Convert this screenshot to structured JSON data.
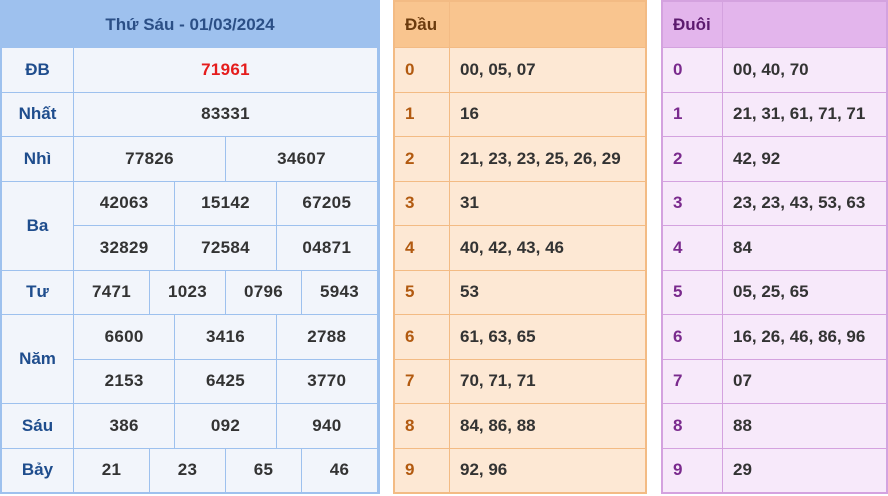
{
  "results": {
    "title": "Thứ Sáu - 01/03/2024",
    "rows": [
      {
        "label": "ĐB",
        "values": [
          "71961"
        ],
        "special": true
      },
      {
        "label": "Nhất",
        "values": [
          "83331"
        ]
      },
      {
        "label": "Nhì",
        "values": [
          "77826",
          "34607"
        ]
      },
      {
        "label": "Ba",
        "values": [
          "42063",
          "15142",
          "67205",
          "32829",
          "72584",
          "04871"
        ]
      },
      {
        "label": "Tư",
        "values": [
          "7471",
          "1023",
          "0796",
          "5943"
        ]
      },
      {
        "label": "Năm",
        "values": [
          "6600",
          "3416",
          "2788",
          "2153",
          "6425",
          "3770"
        ]
      },
      {
        "label": "Sáu",
        "values": [
          "386",
          "092",
          "940"
        ]
      },
      {
        "label": "Bảy",
        "values": [
          "21",
          "23",
          "65",
          "46"
        ]
      }
    ]
  },
  "dau": {
    "header": "Đầu",
    "rows": [
      {
        "key": "0",
        "value": "00, 05, 07"
      },
      {
        "key": "1",
        "value": "16"
      },
      {
        "key": "2",
        "value": "21, 23, 23, 25, 26, 29"
      },
      {
        "key": "3",
        "value": "31"
      },
      {
        "key": "4",
        "value": "40, 42, 43, 46"
      },
      {
        "key": "5",
        "value": "53"
      },
      {
        "key": "6",
        "value": "61, 63, 65"
      },
      {
        "key": "7",
        "value": "70, 71, 71"
      },
      {
        "key": "8",
        "value": "84, 86, 88"
      },
      {
        "key": "9",
        "value": "92, 96"
      }
    ]
  },
  "duoi": {
    "header": "Đuôi",
    "rows": [
      {
        "key": "0",
        "value": "00, 40, 70"
      },
      {
        "key": "1",
        "value": "21, 31, 61, 71, 71"
      },
      {
        "key": "2",
        "value": "42, 92"
      },
      {
        "key": "3",
        "value": "23, 23, 43, 53, 63"
      },
      {
        "key": "4",
        "value": "84"
      },
      {
        "key": "5",
        "value": "05, 25, 65"
      },
      {
        "key": "6",
        "value": "16, 26, 46, 86, 96"
      },
      {
        "key": "7",
        "value": "07"
      },
      {
        "key": "8",
        "value": "88"
      },
      {
        "key": "9",
        "value": "29"
      }
    ]
  }
}
